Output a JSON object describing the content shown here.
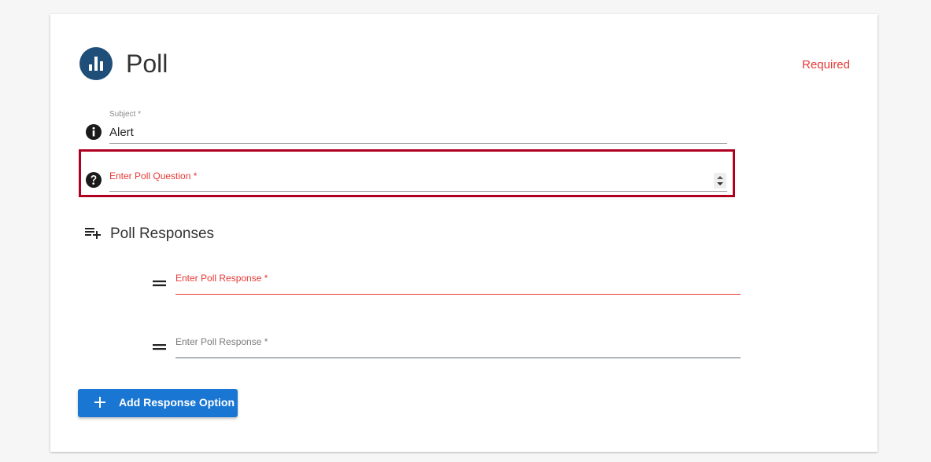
{
  "header": {
    "title": "Poll",
    "required_label": "Required",
    "icon": "bar-chart-icon"
  },
  "subject": {
    "label": "Subject *",
    "value": "Alert",
    "icon": "info-icon"
  },
  "question": {
    "placeholder": "Enter Poll Question *",
    "icon": "help-icon"
  },
  "responses": {
    "title": "Poll Responses",
    "icon": "playlist-add-icon",
    "items": [
      {
        "placeholder": "Enter Poll Response *",
        "handle_icon": "drag-handle-icon"
      },
      {
        "placeholder": "Enter Poll Response *",
        "handle_icon": "drag-handle-icon"
      }
    ]
  },
  "add_button": {
    "label": "Add Response Option",
    "icon": "plus-icon"
  },
  "colors": {
    "accent": "#1976d2",
    "error": "#e53935",
    "highlight": "#b00020",
    "logo": "#1f4e79"
  }
}
